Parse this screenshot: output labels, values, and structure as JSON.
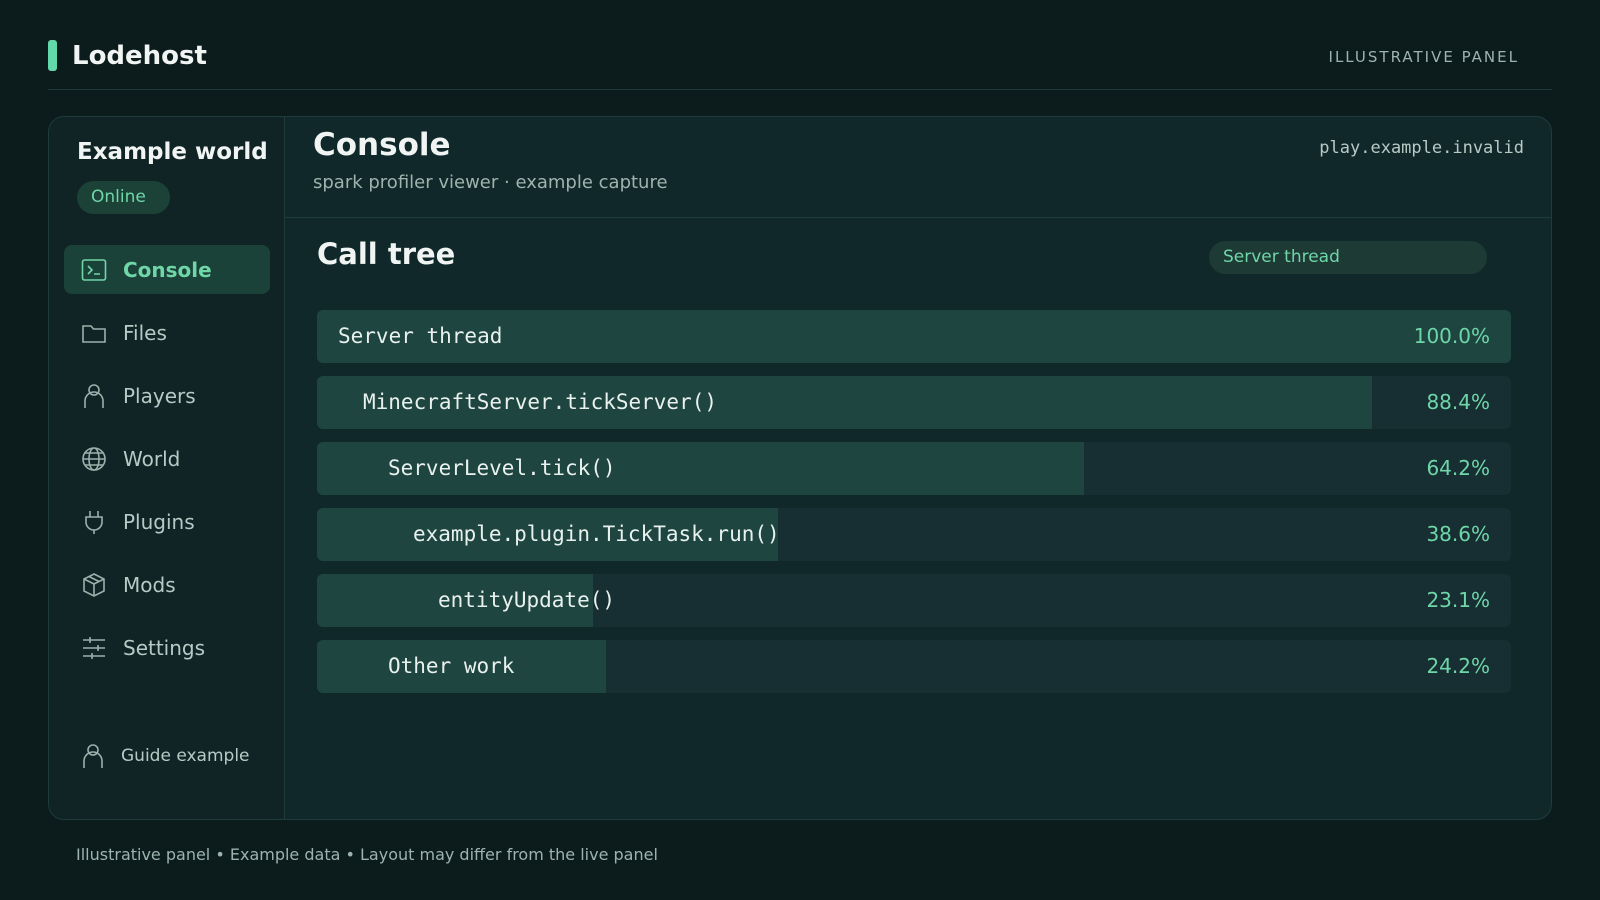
{
  "header": {
    "brand": "Lodehost",
    "tag": "ILLUSTRATIVE PANEL"
  },
  "sidebar": {
    "world_name": "Example world",
    "status": "Online",
    "items": [
      {
        "label": "Console",
        "icon": "terminal-icon",
        "active": true
      },
      {
        "label": "Files",
        "icon": "folder-icon",
        "active": false
      },
      {
        "label": "Players",
        "icon": "user-icon",
        "active": false
      },
      {
        "label": "World",
        "icon": "globe-icon",
        "active": false
      },
      {
        "label": "Plugins",
        "icon": "plug-icon",
        "active": false
      },
      {
        "label": "Mods",
        "icon": "box-icon",
        "active": false
      },
      {
        "label": "Settings",
        "icon": "sliders-icon",
        "active": false
      }
    ],
    "guide": "Guide example"
  },
  "main": {
    "title": "Console",
    "subtitle": "spark profiler viewer · example capture",
    "host": "play.example.invalid",
    "section_title": "Call tree",
    "thread_select": "Server thread",
    "rows": [
      {
        "label": "Server thread",
        "percent": "100.0%",
        "value": 100.0,
        "depth": 0
      },
      {
        "label": "MinecraftServer.tickServer()",
        "percent": "88.4%",
        "value": 88.4,
        "depth": 1
      },
      {
        "label": "ServerLevel.tick()",
        "percent": "64.2%",
        "value": 64.2,
        "depth": 2
      },
      {
        "label": "example.plugin.TickTask.run()",
        "percent": "38.6%",
        "value": 38.6,
        "depth": 3
      },
      {
        "label": "entityUpdate()",
        "percent": "23.1%",
        "value": 23.1,
        "depth": 4
      },
      {
        "label": "Other work",
        "percent": "24.2%",
        "value": 24.2,
        "depth": 2
      }
    ]
  },
  "footer": "Illustrative panel • Example data • Layout may differ from the live panel",
  "colors": {
    "accent": "#63d8aa",
    "background": "#0c1c1c",
    "panel": "#11282a"
  }
}
